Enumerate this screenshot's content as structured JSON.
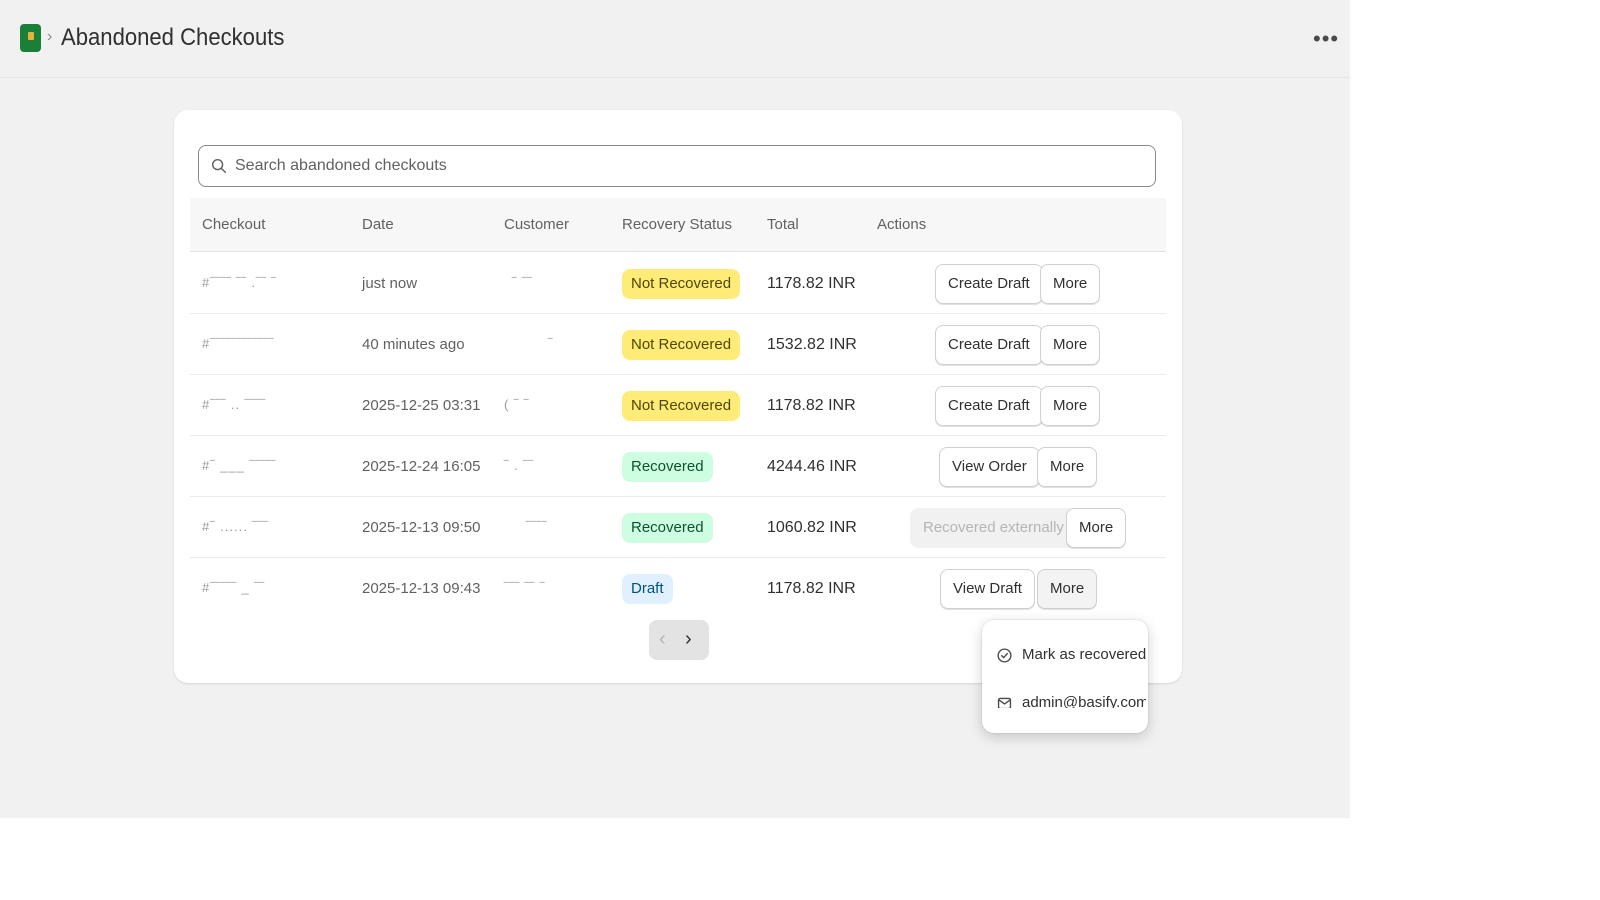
{
  "header": {
    "title": "Abandoned Checkouts",
    "breadcrumb_separator": "›",
    "more_icon": "•••"
  },
  "search": {
    "placeholder": "Search abandoned checkouts",
    "value": ""
  },
  "table": {
    "columns": [
      "Checkout",
      "Date",
      "Customer",
      "Recovery Status",
      "Total",
      "Actions"
    ],
    "rows": [
      {
        "checkout": "#‾‾‾‾ ‾‾  .‾‾ ‾",
        "date": "just now",
        "customer": "‾ ‾‾",
        "status": "Not Recovered",
        "status_tone": "warning",
        "total": "1178.82 INR",
        "primary_action": "Create Draft",
        "more": "More"
      },
      {
        "checkout": "#‾‾‾‾‾‾‾‾‾‾‾‾",
        "date": "40 minutes ago",
        "customer": "‾",
        "status": "Not Recovered",
        "status_tone": "warning",
        "total": "1532.82 INR",
        "primary_action": "Create Draft",
        "more": "More"
      },
      {
        "checkout": "#‾‾‾ ..  ‾‾‾‾",
        "date": "2025-12-25 03:31",
        "customer": "( ‾ ‾",
        "status": "Not Recovered",
        "status_tone": "warning",
        "total": "1178.82 INR",
        "primary_action": "Create Draft",
        "more": "More"
      },
      {
        "checkout": "#‾ ___  ‾‾‾‾‾",
        "date": "2025-12-24 16:05",
        "customer": "‾  .  ‾‾",
        "status": "Recovered",
        "status_tone": "success",
        "total": "4244.46 INR",
        "primary_action": "View Order",
        "more": "More"
      },
      {
        "checkout": "#‾ ......  ‾‾‾",
        "date": "2025-12-13 09:50",
        "customer": "‾‾‾‾",
        "status": "Recovered",
        "status_tone": "success",
        "total": "1060.82 INR",
        "primary_action": "Recovered externally",
        "more": "More"
      },
      {
        "checkout": "#‾‾‾‾‾ _ ‾‾",
        "date": "2025-12-13 09:43",
        "customer": "‾‾‾ ‾‾ ‾",
        "status": "Draft",
        "status_tone": "info",
        "total": "1178.82 INR",
        "primary_action": "View Draft",
        "more": "More"
      }
    ]
  },
  "pagination": {
    "prev": "‹",
    "next": "›"
  },
  "more_menu": {
    "items": [
      {
        "label": "Mark as recovered",
        "icon": "check-circle-icon"
      },
      {
        "label": "admin@basify.com",
        "icon": "email-icon"
      }
    ]
  },
  "colors": {
    "warning_bg": "#ffeb78",
    "success_bg": "#cdfee1",
    "info_bg": "#e0f0ff",
    "brand": "#1a7f37"
  }
}
